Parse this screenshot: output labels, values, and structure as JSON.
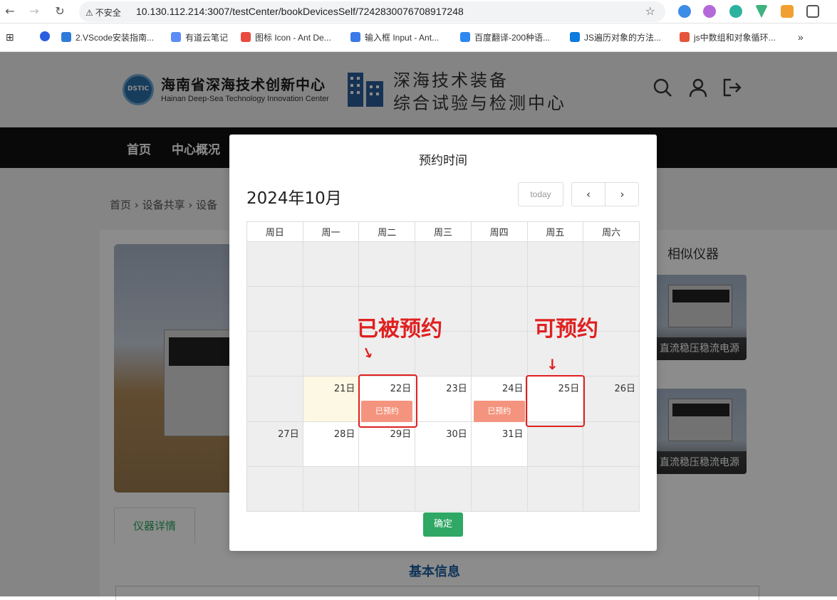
{
  "browser": {
    "insecure_label": "不安全",
    "url": "10.130.112.214:3007/testCenter/bookDevicesSelf/7242830076708917248",
    "bookmarks": [
      {
        "label": "2.VScode安装指南...",
        "color": "#2f7bd8"
      },
      {
        "label": "有道云笔记",
        "color": "#5b8cf5"
      },
      {
        "label": "图标 Icon - Ant De...",
        "color": "#e84a3f"
      },
      {
        "label": "输入框 Input - Ant...",
        "color": "#3a79e8"
      },
      {
        "label": "百度翻译-200种语...",
        "color": "#2e88f0"
      },
      {
        "label": "JS遍历对象的方法...",
        "color": "#0b7be0"
      },
      {
        "label": "js中数组和对象循环...",
        "color": "#e4553b"
      }
    ],
    "more": "»"
  },
  "site": {
    "logo_badge": "DSTIC",
    "logo_cn": "海南省深海技术创新中心",
    "logo_en": "Hainan Deep-Sea Technology Innovation Center",
    "center_title_line1": "深海技术装备",
    "center_title_line2": "综合试验与检测中心",
    "nav": [
      "首页",
      "中心概况"
    ],
    "breadcrumb": [
      "首页",
      "设备共享",
      "设备"
    ],
    "similar_title": "相似仪器",
    "similar_items": [
      "直流稳压稳流电源",
      "直流稳压稳流电源"
    ],
    "tab_detail": "仪器详情",
    "basic_info_title": "基本信息"
  },
  "modal": {
    "title": "预约时间",
    "calendar_title": "2024年10月",
    "today_label": "today",
    "prev_label": "‹",
    "next_label": "›",
    "weekdays": [
      "周日",
      "周一",
      "周二",
      "周三",
      "周四",
      "周五",
      "周六"
    ],
    "weeks": [
      [
        {
          "d": "",
          "s": "dis"
        },
        {
          "d": "",
          "s": "dis"
        },
        {
          "d": "",
          "s": "dis"
        },
        {
          "d": "",
          "s": "dis"
        },
        {
          "d": "",
          "s": "dis"
        },
        {
          "d": "",
          "s": "dis"
        },
        {
          "d": "",
          "s": "dis"
        }
      ],
      [
        {
          "d": "",
          "s": "dis"
        },
        {
          "d": "",
          "s": "dis"
        },
        {
          "d": "",
          "s": "dis"
        },
        {
          "d": "",
          "s": "dis"
        },
        {
          "d": "",
          "s": "dis"
        },
        {
          "d": "",
          "s": "dis"
        },
        {
          "d": "",
          "s": "dis"
        }
      ],
      [
        {
          "d": "",
          "s": "dis"
        },
        {
          "d": "",
          "s": "dis"
        },
        {
          "d": "",
          "s": "dis"
        },
        {
          "d": "",
          "s": "dis"
        },
        {
          "d": "",
          "s": "dis"
        },
        {
          "d": "",
          "s": "dis"
        },
        {
          "d": "",
          "s": "dis"
        }
      ],
      [
        {
          "d": "",
          "s": "dis"
        },
        {
          "d": "21日",
          "s": "today"
        },
        {
          "d": "22日",
          "s": "cur",
          "booked": "已预约"
        },
        {
          "d": "23日",
          "s": "cur"
        },
        {
          "d": "24日",
          "s": "cur",
          "booked": "已预约"
        },
        {
          "d": "25日",
          "s": "cur"
        },
        {
          "d": "26日",
          "s": "dis"
        }
      ],
      [
        {
          "d": "27日",
          "s": "dis"
        },
        {
          "d": "28日",
          "s": "cur"
        },
        {
          "d": "29日",
          "s": "cur"
        },
        {
          "d": "30日",
          "s": "cur"
        },
        {
          "d": "31日",
          "s": "cur"
        },
        {
          "d": "",
          "s": "dis"
        },
        {
          "d": "",
          "s": "dis"
        }
      ],
      [
        {
          "d": "",
          "s": "dis"
        },
        {
          "d": "",
          "s": "dis"
        },
        {
          "d": "",
          "s": "dis"
        },
        {
          "d": "",
          "s": "dis"
        },
        {
          "d": "",
          "s": "dis"
        },
        {
          "d": "",
          "s": "dis"
        },
        {
          "d": "",
          "s": "dis"
        }
      ]
    ],
    "confirm_label": "确定"
  },
  "annotations": {
    "booked_label": "已被预约",
    "available_label": "可预约",
    "arrow": "↓",
    "color": "#e02020"
  }
}
